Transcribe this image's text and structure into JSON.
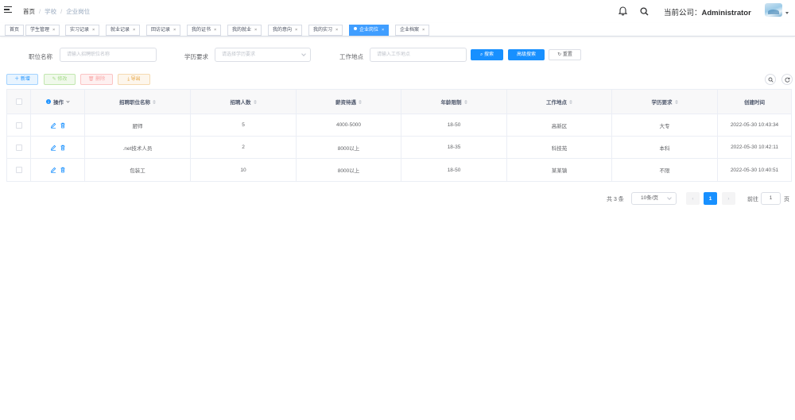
{
  "breadcrumb": [
    "首页",
    "学校",
    "企业岗位"
  ],
  "header": {
    "company_label": "当前公司：",
    "company_name": "Administrator"
  },
  "tags": [
    {
      "label": "首页",
      "closable": false,
      "active": false
    },
    {
      "label": "学生管理",
      "closable": true,
      "active": false
    },
    {
      "label": "实习记录",
      "closable": true,
      "active": false
    },
    {
      "label": "就业记录",
      "closable": true,
      "active": false
    },
    {
      "label": "回访记录",
      "closable": true,
      "active": false
    },
    {
      "label": "我的证书",
      "closable": true,
      "active": false
    },
    {
      "label": "我的就业",
      "closable": true,
      "active": false
    },
    {
      "label": "我的意向",
      "closable": true,
      "active": false
    },
    {
      "label": "我的实习",
      "closable": true,
      "active": false
    },
    {
      "label": "企业岗位",
      "closable": true,
      "active": true
    },
    {
      "label": "企业档案",
      "closable": true,
      "active": false
    }
  ],
  "search_form": {
    "position_label": "职位名称",
    "position_placeholder": "请输入招聘职位名称",
    "education_label": "学历要求",
    "education_placeholder": "请选择学历要求",
    "location_label": "工作地点",
    "location_placeholder": "请输入工作地点",
    "search_button": "搜索",
    "advanced_button": "高级搜索",
    "reset_button": "重置"
  },
  "toolbar": {
    "add": "新增",
    "edit": "修改",
    "delete": "删除",
    "export": "导出"
  },
  "table": {
    "columns": [
      "操作",
      "招聘职位名称",
      "招聘人数",
      "薪资待遇",
      "年龄限制",
      "工作地点",
      "学历要求",
      "创建时间"
    ],
    "rows": [
      {
        "name": "厨师",
        "count": "5",
        "salary": "4000-5000",
        "age": "18-50",
        "location": "高新区",
        "education": "大专",
        "created": "2022-05-30 10:43:34"
      },
      {
        "name": ".net技术人员",
        "count": "2",
        "salary": "8000以上",
        "age": "18-35",
        "location": "科技苑",
        "education": "本科",
        "created": "2022-05-30 10:42:11"
      },
      {
        "name": "包装工",
        "count": "10",
        "salary": "8000以上",
        "age": "18-50",
        "location": "某某镇",
        "education": "不限",
        "created": "2022-05-30 10:40:51"
      }
    ]
  },
  "pagination": {
    "total": "共 3 条",
    "page_size": "10条/页",
    "current": "1",
    "goto_label": "前往",
    "goto_value": "1",
    "page_unit": "页"
  },
  "colors": {
    "primary": "#1890ff",
    "success": "#67c23a",
    "danger": "#f56c6c",
    "warning": "#e6a23c"
  }
}
